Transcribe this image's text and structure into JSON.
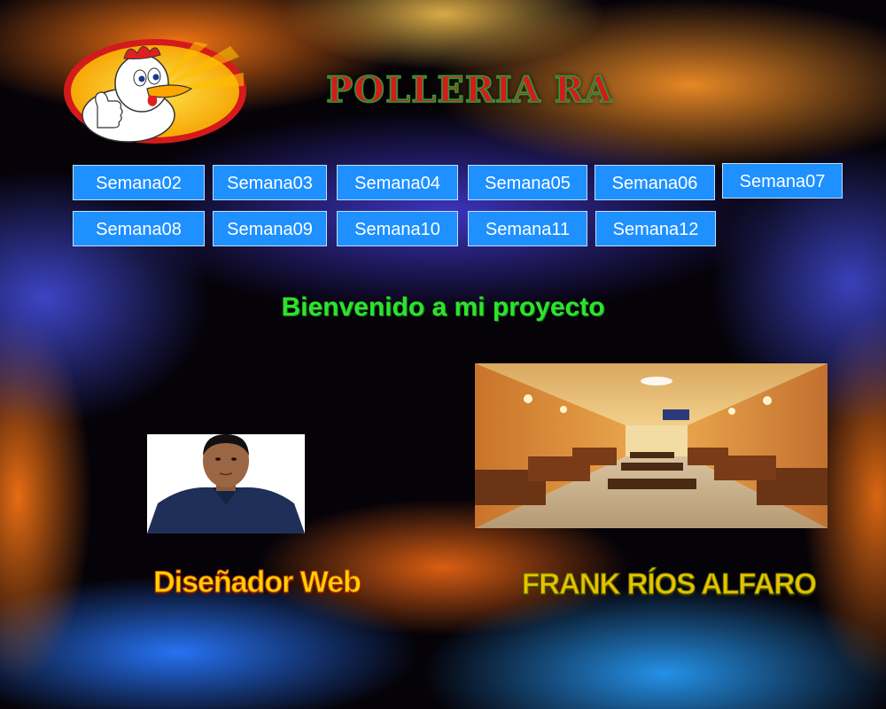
{
  "header": {
    "logo_icon": "chicken-mascot-logo",
    "title": "POLLERIA RA"
  },
  "nav": {
    "items": [
      {
        "label": "Semana02"
      },
      {
        "label": "Semana03"
      },
      {
        "label": "Semana04"
      },
      {
        "label": "Semana05"
      },
      {
        "label": "Semana06"
      },
      {
        "label": "Semana07"
      },
      {
        "label": "Semana08"
      },
      {
        "label": "Semana09"
      },
      {
        "label": "Semana10"
      },
      {
        "label": "Semana11"
      },
      {
        "label": "Semana12"
      }
    ]
  },
  "main": {
    "welcome": "Bienvenido a mi proyecto",
    "role": "Diseñador Web",
    "author": "FRANK RÍOS ALFARO"
  },
  "colors": {
    "nav_button": "#1e90ff",
    "welcome_text": "#2de32d",
    "title_text": "#d21b1b"
  }
}
